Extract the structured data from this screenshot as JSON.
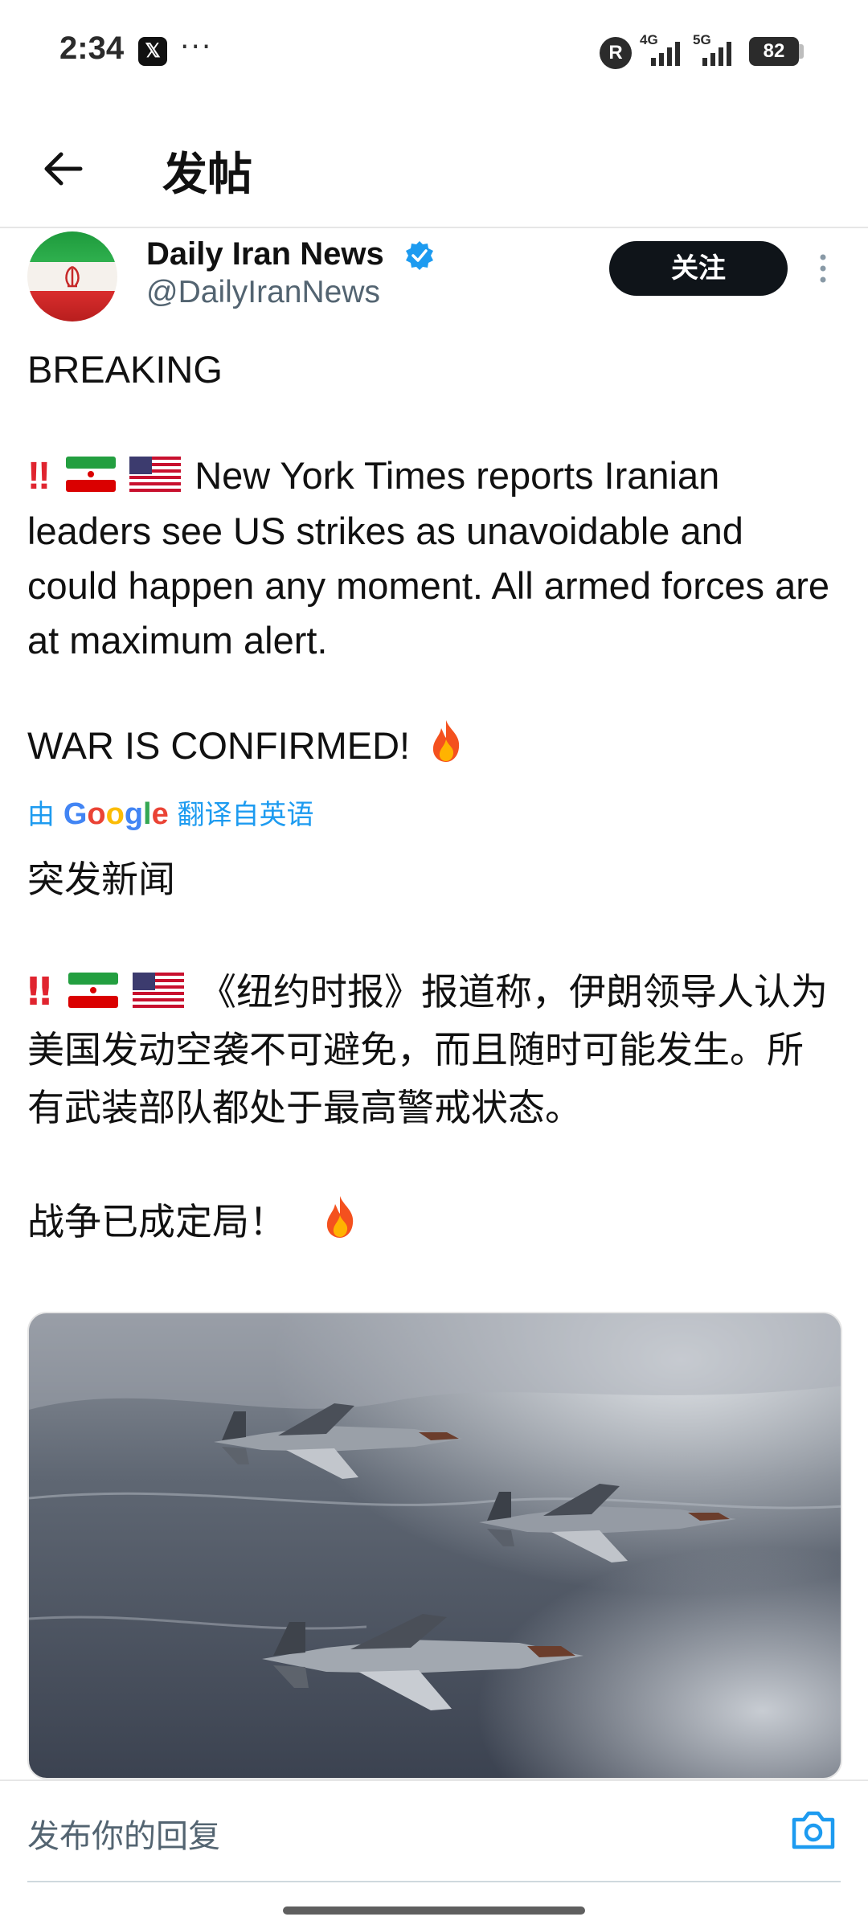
{
  "status_bar": {
    "time": "2:34",
    "x_app_glyph": "𝕏",
    "overflow_dots": "···",
    "r_badge": "R",
    "network_1": "4G",
    "network_2": "5G",
    "battery": "82"
  },
  "header": {
    "back_icon": "arrow-left-icon",
    "title": "发帖"
  },
  "author": {
    "name": "Daily Iran News",
    "handle": "@DailyIranNews",
    "verified": true,
    "follow_label": "关注",
    "avatar_icon": "iran-flag-avatar"
  },
  "tweet": {
    "line_breaking": "BREAKING",
    "body_en": "New York Times reports Iranian leaders see US strikes as unavoidable and could happen any moment. All armed forces are at maximum alert.",
    "war_en": "WAR IS CONFIRMED!",
    "translate_prefix": "由",
    "translate_brand": "Google",
    "translate_suffix": "翻译自英语",
    "line_breaking_cn": "突发新闻",
    "body_cn": "《纽约时报》报道称，伊朗领导人认为美国发动空袭不可避免，而且随时可能发生。所有武装部队都处于最高警戒状态。",
    "war_cn": "战争已成定局！",
    "emoji_alert": "‼",
    "media_alt": "Three fighter jets flying in formation above clouds"
  },
  "reply": {
    "placeholder": "发布你的回复",
    "camera_icon": "camera-icon"
  },
  "colors": {
    "accent": "#1d9bf0",
    "text": "#0f1419",
    "secondary": "#536471",
    "button_bg": "#0f1419"
  }
}
